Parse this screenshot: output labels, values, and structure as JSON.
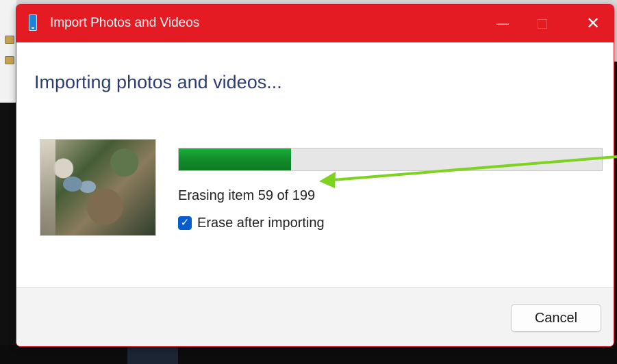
{
  "window": {
    "title": "Import Photos and Videos",
    "title_icon": "phone-icon",
    "titlebar_color": "#E51B23",
    "controls": {
      "minimize_icon": "minimize-icon",
      "maximize_icon": "maximize-icon",
      "close_icon": "close-icon"
    }
  },
  "dialog": {
    "heading": "Importing photos and videos...",
    "progress": {
      "current": 59,
      "total": 199,
      "fraction": 0.265
    },
    "status_text": "Erasing item 59 of 199",
    "erase_after_importing": {
      "label": "Erase after importing",
      "checked": true
    },
    "cancel_label": "Cancel"
  },
  "annotation": {
    "arrow_color": "#7ED321"
  }
}
